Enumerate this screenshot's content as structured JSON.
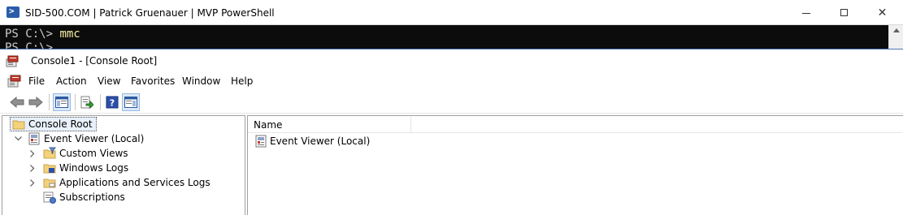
{
  "powershell": {
    "title": "SID-500.COM | Patrick Gruenauer | MVP PowerShell",
    "prompt": "PS C:\\> ",
    "command": "mmc",
    "next_prompt": "PS C:\\>",
    "controls": {
      "minimize": "minimize",
      "maximize": "maximize",
      "close": "✕"
    }
  },
  "mmc": {
    "title": "Console1 - [Console Root]",
    "menu": [
      "File",
      "Action",
      "View",
      "Favorites",
      "Window",
      "Help"
    ],
    "toolbar": [
      {
        "icon": "back-arrow-icon"
      },
      {
        "icon": "forward-arrow-icon"
      },
      {
        "icon": "show-hide-console-tree-icon"
      },
      {
        "icon": "export-list-icon"
      },
      {
        "icon": "help-icon"
      },
      {
        "icon": "show-hide-action-pane-icon"
      }
    ],
    "tree": {
      "root": "Console Root",
      "event_viewer": "Event Viewer (Local)",
      "children": [
        "Custom Views",
        "Windows Logs",
        "Applications and Services Logs",
        "Subscriptions"
      ]
    },
    "list": {
      "columns": [
        "Name"
      ],
      "rows": [
        "Event Viewer (Local)"
      ]
    }
  },
  "colors": {
    "console_bg": "#0c0c0c",
    "console_text": "#cccccc",
    "command_text": "#f9f1a5",
    "selection_bg": "#e8f1fb"
  }
}
